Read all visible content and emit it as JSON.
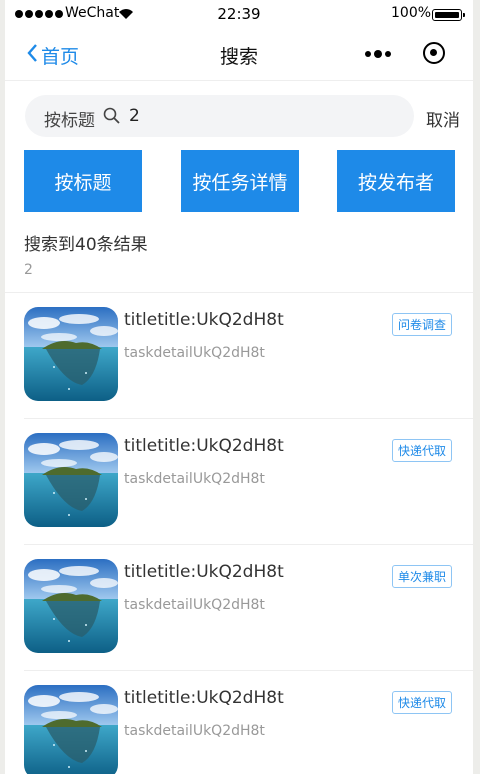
{
  "status_bar": {
    "carrier": "WeChat",
    "time": "22:39",
    "battery": "100%"
  },
  "nav": {
    "back_label": "首页",
    "title": "搜索"
  },
  "search": {
    "prefix": "按标题",
    "value": "2",
    "cancel_label": "取消"
  },
  "filters": [
    {
      "label": "按标题"
    },
    {
      "label": "按任务详情"
    },
    {
      "label": "按发布者"
    }
  ],
  "results": {
    "count_text": "搜索到40条结果",
    "query_echo": "2"
  },
  "items": [
    {
      "title": "titletitle:UkQ2dH8t",
      "detail": "taskdetailUkQ2dH8t",
      "tag": "问卷调查"
    },
    {
      "title": "titletitle:UkQ2dH8t",
      "detail": "taskdetailUkQ2dH8t",
      "tag": "快递代取"
    },
    {
      "title": "titletitle:UkQ2dH8t",
      "detail": "taskdetailUkQ2dH8t",
      "tag": "单次兼职"
    },
    {
      "title": "titletitle:UkQ2dH8t",
      "detail": "taskdetailUkQ2dH8t",
      "tag": "快递代取"
    }
  ],
  "colors": {
    "accent": "#1e8ae8",
    "tag_border": "#8ec5f4",
    "search_bg": "#f3f4f6"
  },
  "icons": {
    "back": "chevron-left-icon",
    "search": "search-icon",
    "more": "more-dots-icon",
    "target": "target-icon"
  }
}
